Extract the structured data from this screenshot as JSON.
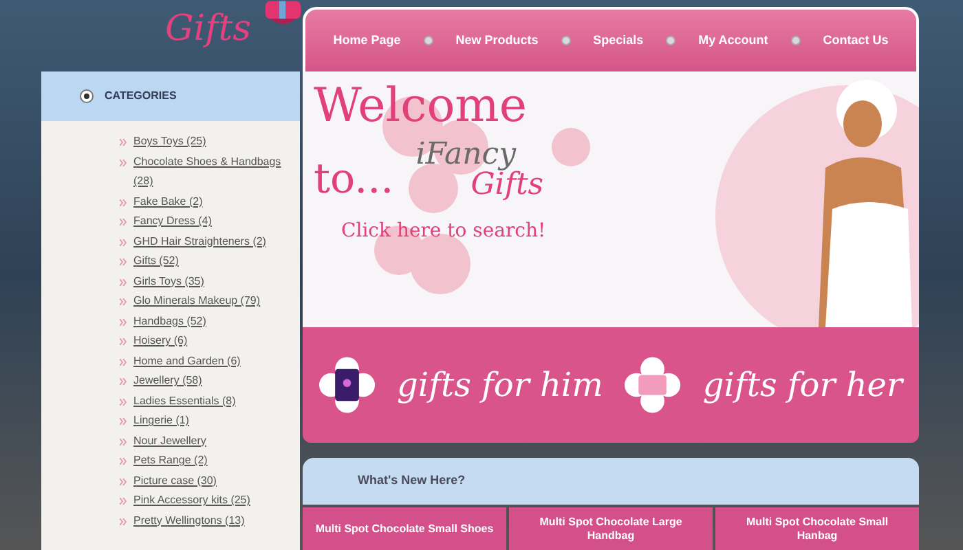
{
  "logo": {
    "text": "Gifts"
  },
  "nav": [
    {
      "label": "Home Page"
    },
    {
      "label": "New Products"
    },
    {
      "label": "Specials"
    },
    {
      "label": "My Account"
    },
    {
      "label": "Contact Us"
    }
  ],
  "sidebar": {
    "title": "CATEGORIES",
    "items": [
      {
        "label": "Boys Toys (25)"
      },
      {
        "label": "Chocolate Shoes & Handbags (28)"
      },
      {
        "label": "Fake Bake (2)"
      },
      {
        "label": "Fancy Dress (4)"
      },
      {
        "label": "GHD Hair Straighteners (2)"
      },
      {
        "label": "Gifts (52)"
      },
      {
        "label": "Girls Toys (35)"
      },
      {
        "label": "Glo Minerals Makeup (79)"
      },
      {
        "label": "Handbags (52)"
      },
      {
        "label": "Hoisery (6)"
      },
      {
        "label": "Home and Garden (6)"
      },
      {
        "label": "Jewellery (58)"
      },
      {
        "label": "Ladies Essentials (8)"
      },
      {
        "label": "Lingerie (1)"
      },
      {
        "label": "Nour Jewellery"
      },
      {
        "label": "Pets Range (2)"
      },
      {
        "label": "Picture case (30)"
      },
      {
        "label": "Pink Accessory kits (25)"
      },
      {
        "label": "Pretty Wellingtons (13)"
      }
    ]
  },
  "banner": {
    "welcome": "Welcome",
    "to": "to...",
    "brand_top": "iFancy",
    "brand_bottom": "Gifts",
    "search_link": "Click here to search!"
  },
  "gift_band": [
    {
      "label": "gifts for him"
    },
    {
      "label": "gifts for her"
    }
  ],
  "whats_new": {
    "title": "What's New Here?",
    "products": [
      {
        "label": "Multi Spot Chocolate Small Shoes"
      },
      {
        "label": "Multi Spot Chocolate Large Handbag"
      },
      {
        "label": "Multi Spot Chocolate Small Hanbag"
      }
    ]
  }
}
